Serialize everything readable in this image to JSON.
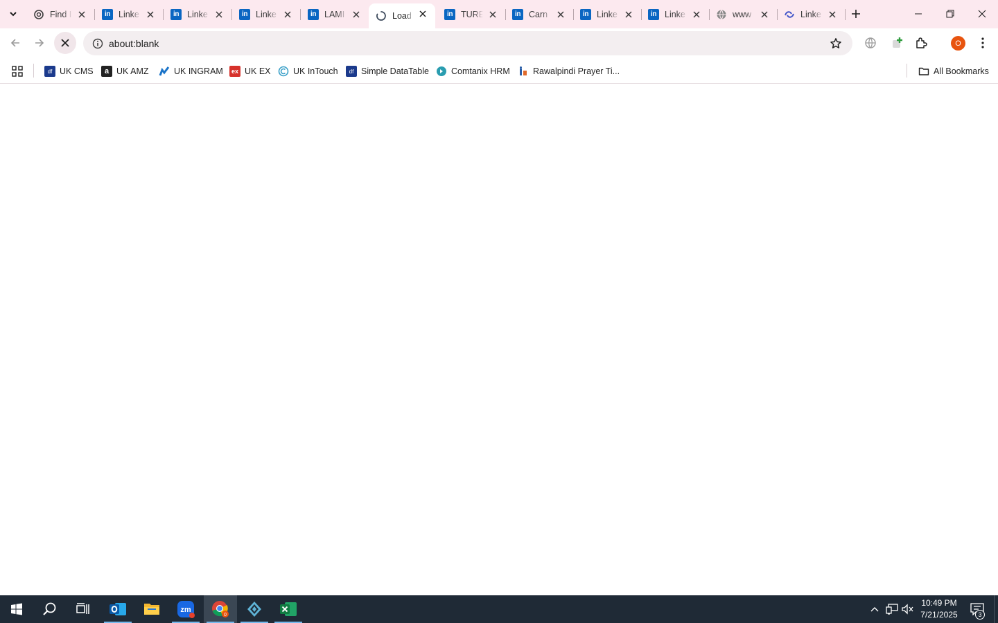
{
  "tabs": [
    {
      "title": "Find I",
      "icon": "openai-icon"
    },
    {
      "title": "Linke",
      "icon": "linkedin-icon"
    },
    {
      "title": "Linke",
      "icon": "linkedin-icon"
    },
    {
      "title": "Linke",
      "icon": "linkedin-icon"
    },
    {
      "title": "LAMI",
      "icon": "linkedin-icon"
    },
    {
      "title": "Load",
      "icon": "loading-spinner-icon",
      "active": true
    },
    {
      "title": "TURE",
      "icon": "linkedin-icon"
    },
    {
      "title": "Carn",
      "icon": "linkedin-icon"
    },
    {
      "title": "Linke",
      "icon": "linkedin-icon"
    },
    {
      "title": "Linke",
      "icon": "linkedin-icon"
    },
    {
      "title": "www",
      "icon": "globe-icon"
    },
    {
      "title": "Linke",
      "icon": "link-icon"
    }
  ],
  "toolbar": {
    "url": "about:blank",
    "profile_initial": "O"
  },
  "bookmarks": [
    {
      "label": "UK CMS",
      "icon": "df-icon"
    },
    {
      "label": "UK AMZ",
      "icon": "amazon-icon"
    },
    {
      "label": "UK INGRAM",
      "icon": "ingram-icon"
    },
    {
      "label": "UK EX",
      "icon": "ex-icon"
    },
    {
      "label": "UK InTouch",
      "icon": "intouch-icon"
    },
    {
      "label": "Simple DataTable",
      "icon": "df-icon"
    },
    {
      "label": "Comtanix HRM",
      "icon": "comtanix-icon"
    },
    {
      "label": "Rawalpindi Prayer Ti...",
      "icon": "prayer-icon"
    }
  ],
  "all_bookmarks_label": "All Bookmarks",
  "taskbar": {
    "time": "10:49 PM",
    "date": "7/21/2025",
    "notification_count": "3",
    "chrome_badge": "0"
  },
  "colors": {
    "tabstrip_bg": "#fce9ef",
    "taskbar_bg": "#1f2a36",
    "linkedin": "#0a66c2",
    "profile": "#e8540f"
  }
}
